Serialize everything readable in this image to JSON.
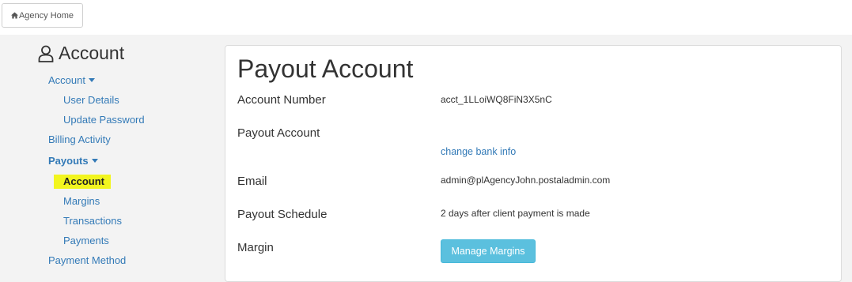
{
  "topbar": {
    "home_label": "Agency Home"
  },
  "sidebar": {
    "title": "Account",
    "items": [
      {
        "label": "Account"
      },
      {
        "label": "User Details"
      },
      {
        "label": "Update Password"
      },
      {
        "label": "Billing Activity"
      },
      {
        "label": "Payouts"
      },
      {
        "label": "Account"
      },
      {
        "label": "Margins"
      },
      {
        "label": "Transactions"
      },
      {
        "label": "Payments"
      },
      {
        "label": "Payment Method"
      }
    ]
  },
  "main": {
    "title": "Payout Account",
    "account_number_label": "Account Number",
    "account_number_value": "acct_1LLoiWQ8FiN3X5nC",
    "payout_account_label": "Payout Account",
    "change_bank_link": "change bank info",
    "email_label": "Email",
    "email_value": "admin@plAgencyJohn.postaladmin.com",
    "schedule_label": "Payout Schedule",
    "schedule_value": "2 days after client payment is made",
    "margin_label": "Margin",
    "manage_margins_button": "Manage Margins"
  },
  "colors": {
    "link": "#337ab7",
    "highlight": "#f2f51f",
    "button": "#5bc0de"
  },
  "icons": {
    "home": "home-icon",
    "user": "user-icon",
    "caret": "caret-down-icon"
  }
}
